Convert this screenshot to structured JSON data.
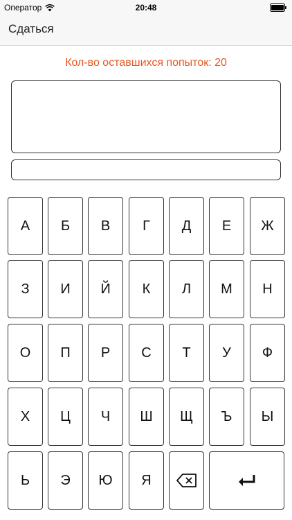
{
  "status_bar": {
    "carrier": "Оператор",
    "time": "20:48"
  },
  "nav": {
    "surrender_label": "Сдаться"
  },
  "game": {
    "attempts_text": "Кол-во оставшихся попыток: 20",
    "word_display": "",
    "guess_value": ""
  },
  "keyboard": {
    "rows": [
      [
        "А",
        "Б",
        "В",
        "Г",
        "Д",
        "Е",
        "Ж"
      ],
      [
        "З",
        "И",
        "Й",
        "К",
        "Л",
        "М",
        "Н"
      ],
      [
        "О",
        "П",
        "Р",
        "С",
        "Т",
        "У",
        "Ф"
      ],
      [
        "Х",
        "Ц",
        "Ч",
        "Ш",
        "Щ",
        "Ъ",
        "Ы"
      ],
      [
        "Ь",
        "Э",
        "Ю",
        "Я"
      ]
    ],
    "backspace_icon": "backspace-icon",
    "enter_icon": "enter-icon"
  },
  "colors": {
    "accent": "#e8581f",
    "border": "#333333"
  }
}
